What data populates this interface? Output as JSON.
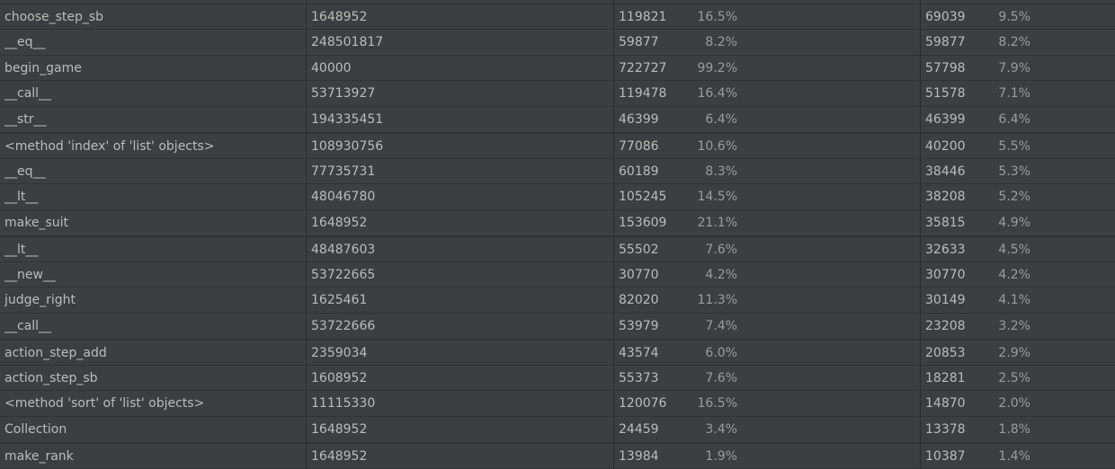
{
  "table": {
    "rows": [
      {
        "name": "choose_step_sb",
        "calls": "1648952",
        "time": "119821",
        "time_pct": "16.5%",
        "own": "69039",
        "own_pct": "9.5%"
      },
      {
        "name": "__eq__",
        "calls": "248501817",
        "time": "59877",
        "time_pct": "8.2%",
        "own": "59877",
        "own_pct": "8.2%"
      },
      {
        "name": "begin_game",
        "calls": "40000",
        "time": "722727",
        "time_pct": "99.2%",
        "own": "57798",
        "own_pct": "7.9%"
      },
      {
        "name": "__call__",
        "calls": "53713927",
        "time": "119478",
        "time_pct": "16.4%",
        "own": "51578",
        "own_pct": "7.1%"
      },
      {
        "name": "__str__",
        "calls": "194335451",
        "time": "46399",
        "time_pct": "6.4%",
        "own": "46399",
        "own_pct": "6.4%"
      },
      {
        "name": "<method 'index' of 'list' objects>",
        "calls": "108930756",
        "time": "77086",
        "time_pct": "10.6%",
        "own": "40200",
        "own_pct": "5.5%"
      },
      {
        "name": "__eq__",
        "calls": "77735731",
        "time": "60189",
        "time_pct": "8.3%",
        "own": "38446",
        "own_pct": "5.3%"
      },
      {
        "name": "__lt__",
        "calls": "48046780",
        "time": "105245",
        "time_pct": "14.5%",
        "own": "38208",
        "own_pct": "5.2%"
      },
      {
        "name": "make_suit",
        "calls": "1648952",
        "time": "153609",
        "time_pct": "21.1%",
        "own": "35815",
        "own_pct": "4.9%"
      },
      {
        "name": "__lt__",
        "calls": "48487603",
        "time": "55502",
        "time_pct": "7.6%",
        "own": "32633",
        "own_pct": "4.5%"
      },
      {
        "name": "__new__",
        "calls": "53722665",
        "time": "30770",
        "time_pct": "4.2%",
        "own": "30770",
        "own_pct": "4.2%"
      },
      {
        "name": "judge_right",
        "calls": "1625461",
        "time": "82020",
        "time_pct": "11.3%",
        "own": "30149",
        "own_pct": "4.1%"
      },
      {
        "name": "__call__",
        "calls": "53722666",
        "time": "53979",
        "time_pct": "7.4%",
        "own": "23208",
        "own_pct": "3.2%"
      },
      {
        "name": "action_step_add",
        "calls": "2359034",
        "time": "43574",
        "time_pct": "6.0%",
        "own": "20853",
        "own_pct": "2.9%"
      },
      {
        "name": "action_step_sb",
        "calls": "1608952",
        "time": "55373",
        "time_pct": "7.6%",
        "own": "18281",
        "own_pct": "2.5%"
      },
      {
        "name": "<method 'sort' of 'list' objects>",
        "calls": "11115330",
        "time": "120076",
        "time_pct": "16.5%",
        "own": "14870",
        "own_pct": "2.0%"
      },
      {
        "name": "Collection",
        "calls": "1648952",
        "time": "24459",
        "time_pct": "3.4%",
        "own": "13378",
        "own_pct": "1.8%"
      },
      {
        "name": "make_rank",
        "calls": "1648952",
        "time": "13984",
        "time_pct": "1.9%",
        "own": "10387",
        "own_pct": "1.4%"
      }
    ]
  },
  "colors": {
    "background": "#3c3f41",
    "text": "#bbbbbb",
    "percent_text": "#9b9b9b",
    "grid_line": "#2b2b2b"
  }
}
